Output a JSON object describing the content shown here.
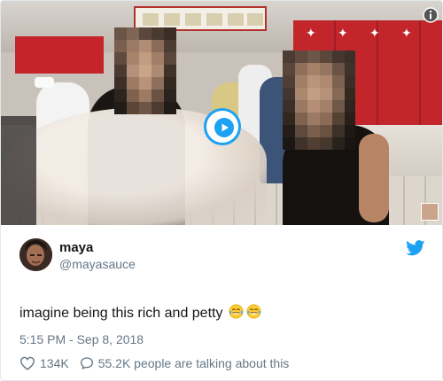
{
  "colors": {
    "accent": "#1da1f2",
    "text_primary": "#14171a",
    "text_secondary": "#657786"
  },
  "media": {
    "type": "video",
    "play_icon": "play-icon",
    "info_icon": "info-icon"
  },
  "tweet": {
    "author_name": "maya",
    "author_handle": "@mayasauce",
    "text": "imagine being this rich and petty",
    "emojis": [
      "face-with-tears-of-joy",
      "face-with-tears-of-joy"
    ],
    "timestamp": "5:15 PM - Sep 8, 2018",
    "likes": "134K",
    "conversation": "55.2K people are talking about this",
    "like_icon": "heart-icon",
    "conversation_icon": "speech-bubble-icon",
    "brand_icon": "twitter-bird-icon"
  }
}
